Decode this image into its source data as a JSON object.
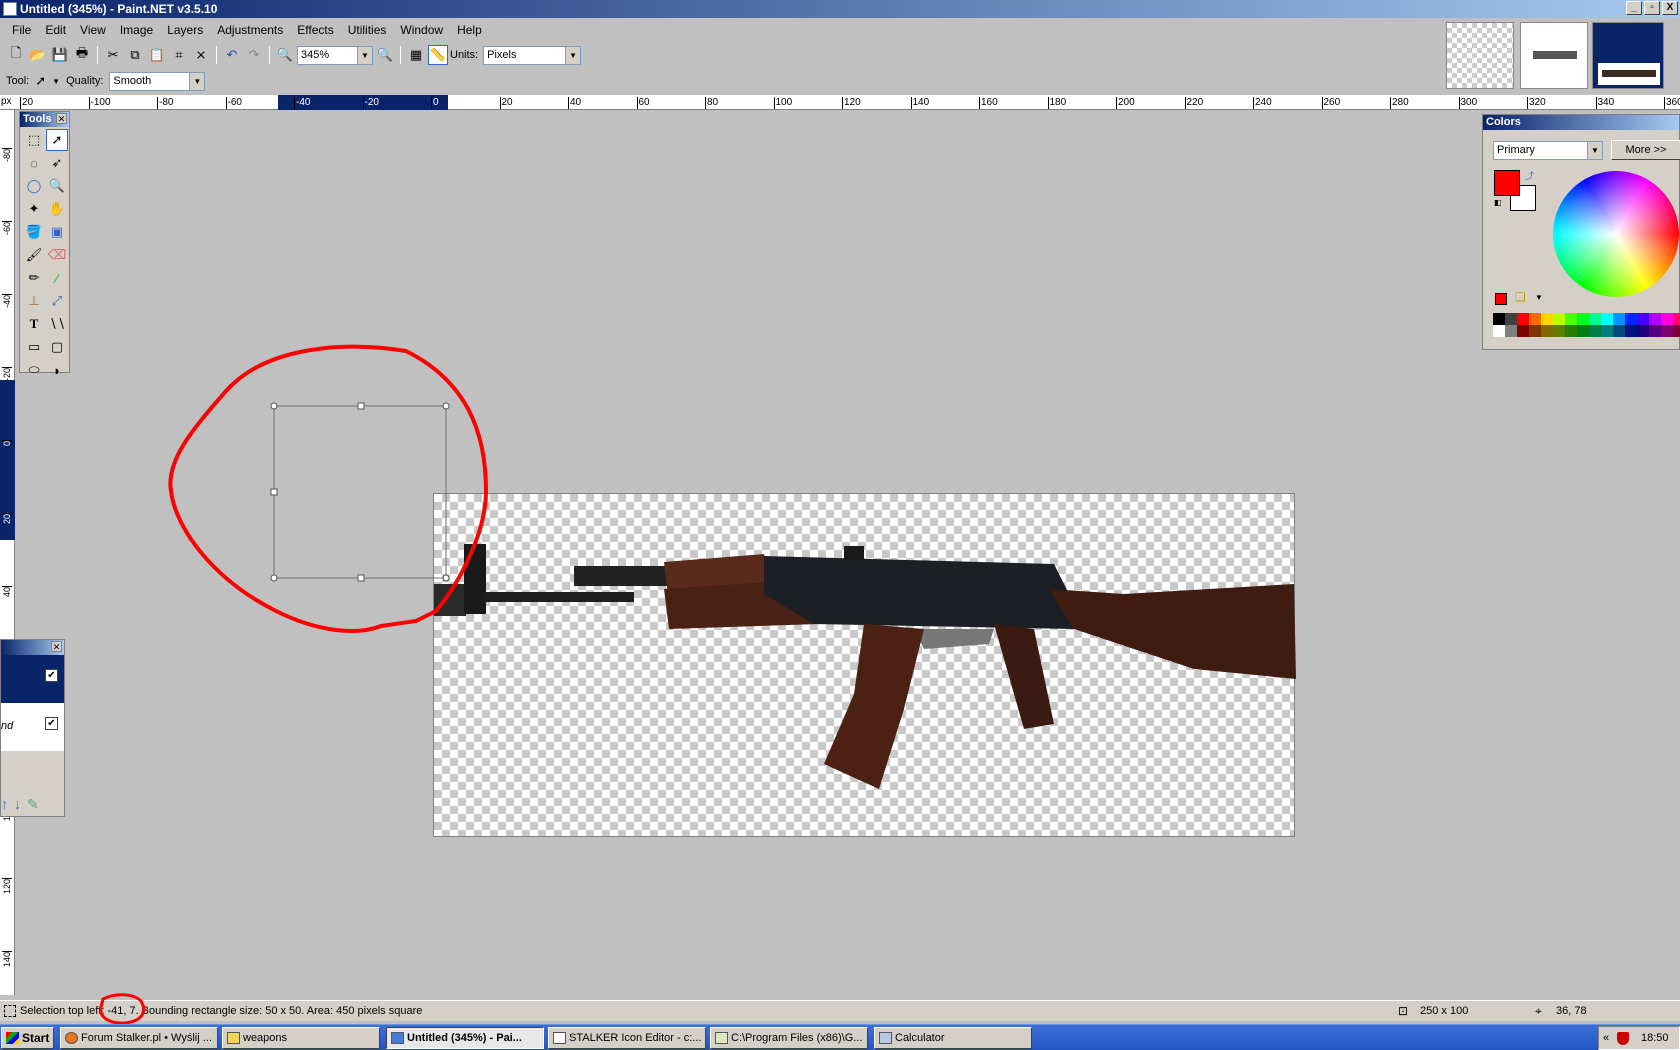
{
  "window": {
    "title": "Untitled (345%) - Paint.NET v3.5.10",
    "minimize": "_",
    "maximize": "▫",
    "close": "X"
  },
  "menu": [
    "File",
    "Edit",
    "View",
    "Image",
    "Layers",
    "Adjustments",
    "Effects",
    "Utilities",
    "Window",
    "Help"
  ],
  "toolbar": {
    "zoom_value": "345%",
    "units_label": "Units:",
    "units_value": "Pixels",
    "tool_label": "Tool:",
    "quality_label": "Quality:",
    "quality_value": "Smooth"
  },
  "rulers": {
    "unit": "px",
    "h_ticks": [
      "20",
      "-100",
      "-80",
      "-60",
      "-40",
      "-20",
      "0",
      "20",
      "40",
      "60",
      "80",
      "100",
      "120",
      "140",
      "160",
      "180",
      "200",
      "220",
      "240",
      "260",
      "280",
      "300",
      "320",
      "340",
      "360"
    ],
    "v_ticks": [
      "-80",
      "-60",
      "-40",
      "-20",
      "0",
      "20",
      "40",
      "60",
      "80",
      "100",
      "120",
      "140",
      "160"
    ]
  },
  "tools_panel": {
    "title": "Tools"
  },
  "colors_panel": {
    "title": "Colors",
    "mode": "Primary",
    "more_button": "More >>",
    "primary_color": "#ff0000",
    "secondary_color": "#ffffff"
  },
  "layers_panel": {
    "layers": [
      {
        "name": "",
        "checked": true,
        "selected": true
      },
      {
        "name": "nd",
        "checked": true,
        "selected": false
      }
    ]
  },
  "palette": {
    "row1": [
      "#000000",
      "#404040",
      "#ff0000",
      "#ff6a00",
      "#ffd800",
      "#b6ff00",
      "#4cff00",
      "#00ff21",
      "#00ff90",
      "#00ffff",
      "#0094ff",
      "#0026ff",
      "#4800ff",
      "#b200ff",
      "#ff00dc",
      "#ff006e"
    ],
    "row2": [
      "#ffffff",
      "#808080",
      "#7f0000",
      "#7f3300",
      "#7f6a00",
      "#5b7f00",
      "#267f00",
      "#007f0e",
      "#007f46",
      "#007f7f",
      "#004a7f",
      "#00137f",
      "#21007f",
      "#57007f",
      "#7f006e",
      "#7f0037"
    ]
  },
  "status": {
    "selection_text": "Selection top left: -41, 7. Bounding rectangle size: 50 x 50. Area: 450 pixels square",
    "image_size": "250 x 100",
    "cursor_pos": "36, 78"
  },
  "taskbar": {
    "start": "Start",
    "items": [
      "Forum Stalker.pl • Wyślij ...",
      "weapons",
      "Untitled (345%) - Pai...",
      "STALKER Icon Editor - c:...",
      "C:\\Program Files (x86)\\G...",
      "Calculator"
    ],
    "tray_expand": "«",
    "clock": "18:50"
  }
}
